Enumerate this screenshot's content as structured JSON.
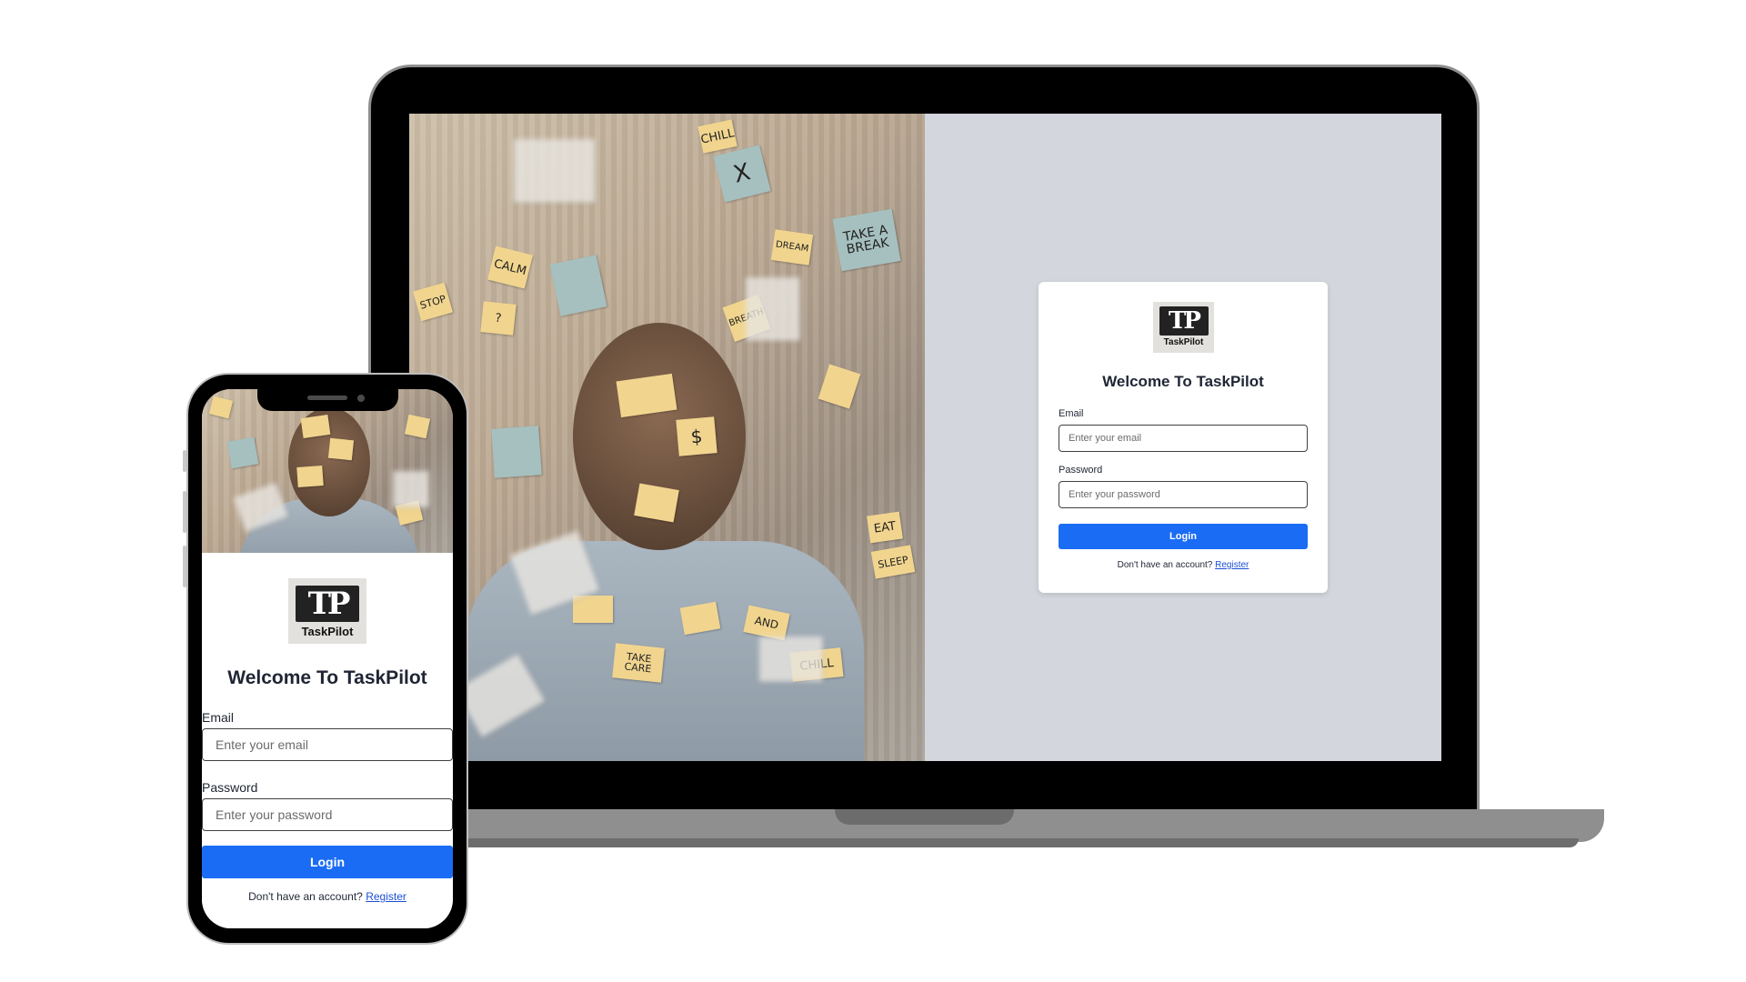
{
  "app": {
    "brand_name": "TaskPilot",
    "logo_mark": "TP",
    "welcome_title": "Welcome To TaskPilot"
  },
  "form": {
    "email_label": "Email",
    "email_placeholder": "Enter your email",
    "password_label": "Password",
    "password_placeholder": "Enter your password",
    "login_label": "Login",
    "footer_text": "Don't have an account?",
    "register_link": "Register"
  },
  "photo": {
    "notes": [
      "CHILL",
      "TAKE A BREAK",
      "EAT",
      "SLEEP",
      "CALM",
      "STOP",
      "$",
      "AND",
      "CHILL",
      "TAKE CARE",
      "BREATH",
      "DREAM",
      "X",
      "?"
    ]
  },
  "colors": {
    "accent": "#1a6cf5",
    "panel_background": "#d3d6dd",
    "link": "#1a4fd6"
  }
}
